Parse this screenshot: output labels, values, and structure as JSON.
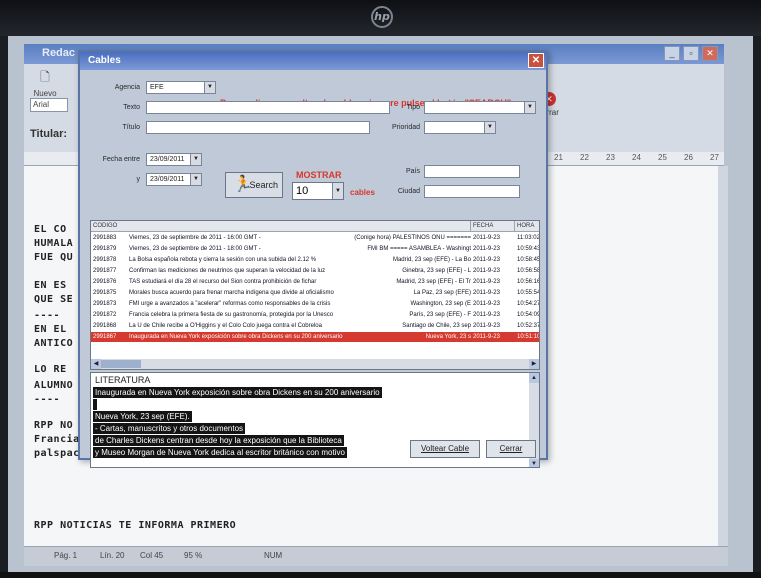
{
  "bg_app": {
    "title": "Redac",
    "new_label": "Nuevo",
    "font_value": "Arial",
    "titular_label": "Titular:",
    "right_label": "errar",
    "ruler_marks": [
      "21",
      "22",
      "23",
      "24",
      "25",
      "26",
      "27"
    ],
    "doc_lines": [
      "EL CO",
      "HUMALA",
      "FUE QU",
      "EN ES",
      "QUE SE",
      "----",
      "EN EL",
      "ANTICO",
      "LO RE",
      "ALUMNO",
      "----",
      "RPP NO",
      "Francia",
      "palspac",
      "RPP NOTICIAS TE INFORMA PRIMERO"
    ],
    "status": {
      "page": "Pág. 1",
      "line": "Lín. 20",
      "col": "Col 45",
      "zoom": "95 %",
      "num": "NUM"
    }
  },
  "dialog": {
    "title": "Cables",
    "notice": "Para realizar consultas de cables siempre pulse el botón \"SEARCH\"",
    "agencia_label": "Agencia",
    "agencia_value": "EFE",
    "texto_label": "Texto",
    "titulo_label": "Título",
    "tipo_label": "Tipo",
    "prioridad_label": "Prioridad",
    "fecha_label": "Fecha entre",
    "fecha_from": "23/09/2011",
    "y_label": "y",
    "fecha_to": "23/09/2011",
    "pais_label": "País",
    "ciudad_label": "Ciudad",
    "search_label": "Search",
    "mostrar_label": "MOSTRAR",
    "mostrar_value": "10",
    "cables_label": "cables",
    "columns": {
      "codigo": "CODIGO",
      "fecha": "FECHA",
      "hora": "HORA"
    },
    "rows": [
      {
        "code": "2991883",
        "title": "Viernes, 23 de septiembre de 2011 - 16:00 GMT -",
        "extra": "(Conige hora)   PALESTINOS ONU  =======",
        "fecha": "2011-9-23",
        "hora": "11:03:02"
      },
      {
        "code": "2991879",
        "title": "Viernes, 23 de septiembre de 2011 - 18:00 GMT -",
        "extra": "FMI BM  =====    ASAMBLEA - Washingt",
        "fecha": "2011-9-23",
        "hora": "10:59:43"
      },
      {
        "code": "2991878",
        "title": "La Bolsa española rebota y cierra la sesión con una subida del 2.12 %",
        "extra": "Madrid, 23 sep (EFE) - La Bo",
        "fecha": "2011-9-23",
        "hora": "10:58:45"
      },
      {
        "code": "2991877",
        "title": "Confirman las mediciones de neutrinos que superan la velocidad de la luz",
        "extra": "Ginebra, 23 sep (EFE) - L",
        "fecha": "2011-9-23",
        "hora": "10:56:58"
      },
      {
        "code": "2991876",
        "title": "TAS estudiará el día 28 el recurso del Sion contra prohibición de fichar",
        "extra": "Madrid, 23 sep (EFE) - El Tr",
        "fecha": "2011-9-23",
        "hora": "10:56:16"
      },
      {
        "code": "2991875",
        "title": "Morales busca acuerdo para frenar marcha indígena que divide al oficialismo",
        "extra": "La Paz, 23 sep (EFE)",
        "fecha": "2011-9-23",
        "hora": "10:55:54"
      },
      {
        "code": "2991873",
        "title": "FMI urge a avanzados a \"acelerar\" reformas como responsables de la crisis",
        "extra": "Washington, 23 sep (E",
        "fecha": "2011-9-23",
        "hora": "10:54:27"
      },
      {
        "code": "2991872",
        "title": "Francia celebra la primera fiesta de su gastronomía, protegida por la Unesco",
        "extra": "París, 23 sep (EFE) - F",
        "fecha": "2011-9-23",
        "hora": "10:54:09"
      },
      {
        "code": "2991868",
        "title": "La U de Chile recibe a O'Higgins y el Colo Colo juega contra el Cobreloa",
        "extra": "Santiago de Chile, 23 sep",
        "fecha": "2011-9-23",
        "hora": "10:52:37"
      },
      {
        "code": "2991867",
        "title": "Inaugurada en Nueva York exposición sobre obra Dickens en su 200 aniversario",
        "extra": "Nueva York, 23 s",
        "fecha": "2011-9-23",
        "hora": "10:51:10"
      }
    ],
    "detail_heading": "LITERATURA",
    "detail_lines": [
      "Inaugurada en Nueva York exposición sobre obra Dickens en su 200 aniversario",
      "  ",
      "Nueva York, 23 sep (EFE).",
      "- Cartas, manuscritos y otros documentos",
      "de Charles Dickens centran desde hoy la exposición que la Biblioteca",
      "y Museo Morgan de Nueva York dedica al escritor británico con motivo"
    ],
    "volcar_label": "Voltear Cable",
    "cerrar_label": "Cerrar"
  }
}
